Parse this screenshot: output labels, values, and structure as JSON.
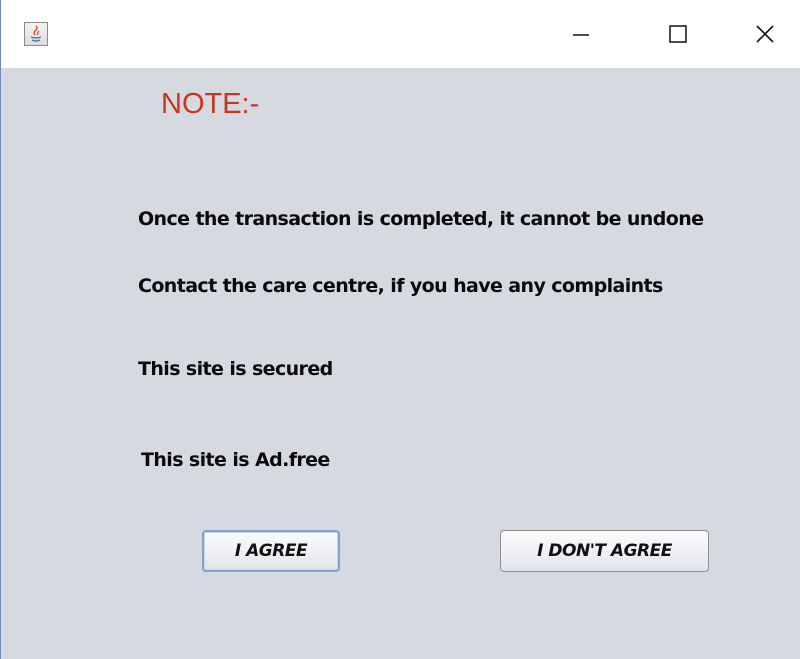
{
  "window": {
    "icon": "java-icon",
    "controls": {
      "minimize": "minimize-icon",
      "maximize": "maximize-icon",
      "close": "close-icon"
    }
  },
  "note": {
    "title": "NOTE:-",
    "title_color": "#c6381c"
  },
  "messages": [
    "Once the transaction is completed, it cannot be undone",
    "Contact the care centre, if you have any complaints",
    "This site is secured",
    "This site is Ad.free"
  ],
  "buttons": {
    "agree": "I AGREE",
    "disagree": "I DON'T AGREE"
  },
  "colors": {
    "content_background": "#d7d9e0",
    "focus_border": "#7fa3cf"
  }
}
